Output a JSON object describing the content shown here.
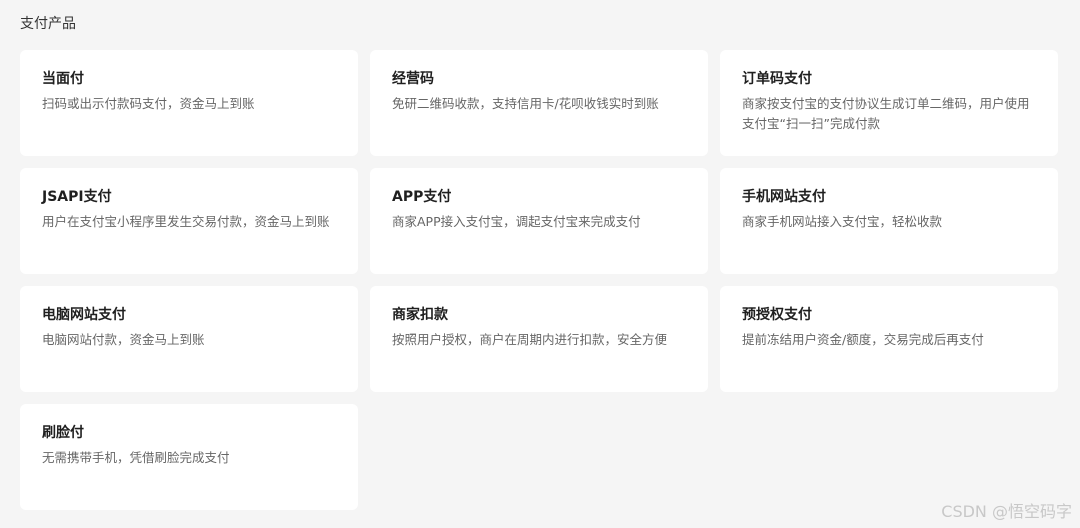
{
  "section": {
    "title": "支付产品"
  },
  "products": [
    {
      "title": "当面付",
      "desc": "扫码或出示付款码支付，资金马上到账"
    },
    {
      "title": "经营码",
      "desc": "免研二维码收款，支持信用卡/花呗收钱实时到账"
    },
    {
      "title": "订单码支付",
      "desc": "商家按支付宝的支付协议生成订单二维码，用户使用支付宝“扫一扫”完成付款"
    },
    {
      "title": "JSAPI支付",
      "desc": "用户在支付宝小程序里发生交易付款，资金马上到账"
    },
    {
      "title": "APP支付",
      "desc": "商家APP接入支付宝，调起支付宝来完成支付"
    },
    {
      "title": "手机网站支付",
      "desc": "商家手机网站接入支付宝，轻松收款"
    },
    {
      "title": "电脑网站支付",
      "desc": "电脑网站付款，资金马上到账"
    },
    {
      "title": "商家扣款",
      "desc": "按照用户授权，商户在周期内进行扣款，安全方便"
    },
    {
      "title": "预授权支付",
      "desc": "提前冻结用户资金/额度，交易完成后再支付"
    },
    {
      "title": "刷脸付",
      "desc": "无需携带手机，凭借刷脸完成支付"
    }
  ],
  "watermark": "CSDN @悟空码字"
}
